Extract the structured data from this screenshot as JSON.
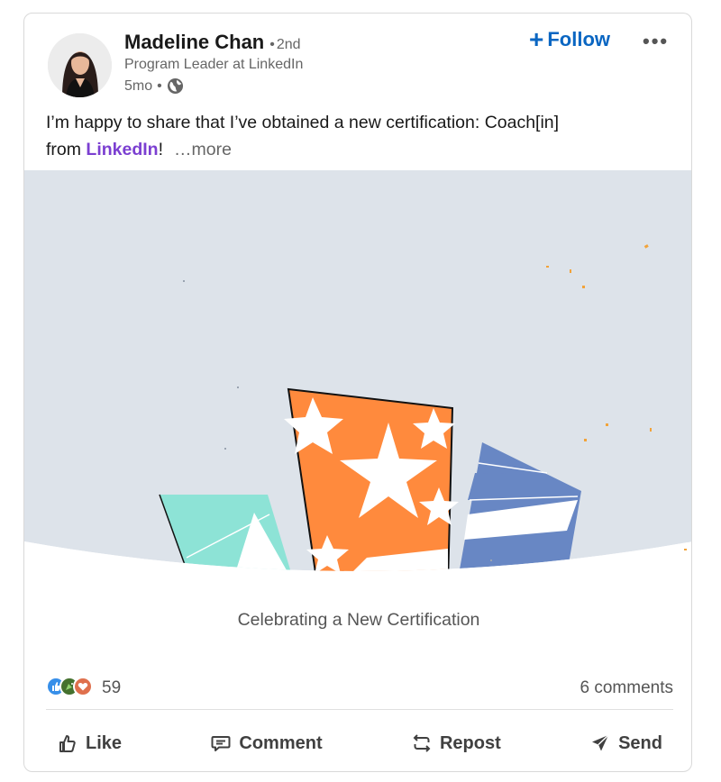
{
  "post": {
    "author": {
      "name": "Madeline Chan",
      "degree": "2nd",
      "headline": "Program Leader at LinkedIn",
      "time_ago": "5mo",
      "visibility_icon": "globe-icon"
    },
    "follow_label": "Follow",
    "more_icon": "more-menu-icon",
    "text": {
      "line_1": "I’m happy to share that I’ve obtained a new certification: Coach[in]",
      "line_2_prefix": "from ",
      "mention": "LinkedIn",
      "line_2_suffix": "!",
      "see_more": "…more"
    },
    "media": {
      "caption": "Celebrating a New Certification",
      "colors": {
        "background": "#dde3ea",
        "orange": "#ff8a3d",
        "teal": "#8de3d6",
        "blue": "#6887c4"
      }
    }
  },
  "social": {
    "reaction_icons": [
      "like-reaction-icon",
      "celebrate-reaction-icon",
      "love-reaction-icon"
    ],
    "reaction_count": "59",
    "comments": "6 comments"
  },
  "actions": {
    "like": "Like",
    "comment": "Comment",
    "repost": "Repost",
    "send": "Send"
  },
  "colors": {
    "accent": "#0a66c2",
    "mention": "#7b3fd1"
  }
}
